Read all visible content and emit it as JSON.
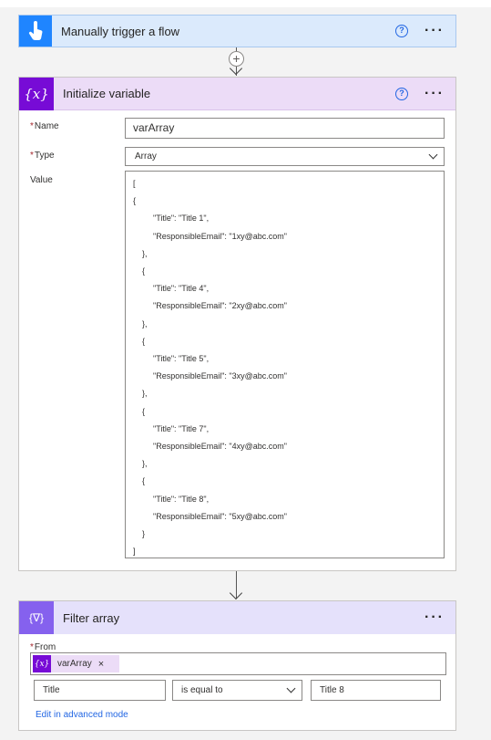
{
  "trigger": {
    "title": "Manually trigger a flow",
    "help_icon": "?",
    "more_icon": "···",
    "icon": "hand-touch-icon"
  },
  "init_variable": {
    "title": "Initialize variable",
    "icon_text": "{x}",
    "help_icon": "?",
    "more_icon": "···",
    "name_label": "Name",
    "name_value": "varArray",
    "type_label": "Type",
    "type_value": "Array",
    "value_label": "Value",
    "required_mark": "*",
    "value_lines": [
      "[",
      "{",
      "    \"Title\": \"Title 1\",",
      "    \"ResponsibleEmail\": \"1xy@abc.com\"",
      "},",
      "{",
      "    \"Title\": \"Title 4\",",
      "    \"ResponsibleEmail\": \"2xy@abc.com\"",
      "},",
      "{",
      "    \"Title\": \"Title 5\",",
      "    \"ResponsibleEmail\": \"3xy@abc.com\"",
      "},",
      "{",
      "    \"Title\": \"Title 7\",",
      "    \"ResponsibleEmail\": \"4xy@abc.com\"",
      "},",
      "{",
      "    \"Title\": \"Title 8\",",
      "    \"ResponsibleEmail\": \"5xy@abc.com\"",
      "}",
      "]"
    ]
  },
  "connector": {
    "plus": "+"
  },
  "filter_array": {
    "title": "Filter array",
    "icon_text": "{∇}",
    "more_icon": "···",
    "from_label": "From",
    "required_mark": "*",
    "token_icon_text": "{x}",
    "token_label": "varArray",
    "token_close": "×",
    "condition_left": "Title",
    "condition_operator": "is equal to",
    "condition_right": "Title 8",
    "advanced_link": "Edit in advanced mode"
  },
  "colors": {
    "trigger_accent": "#1f85ff",
    "variable_accent": "#770bd6",
    "filter_accent": "#8561ee",
    "link": "#2266e3"
  }
}
